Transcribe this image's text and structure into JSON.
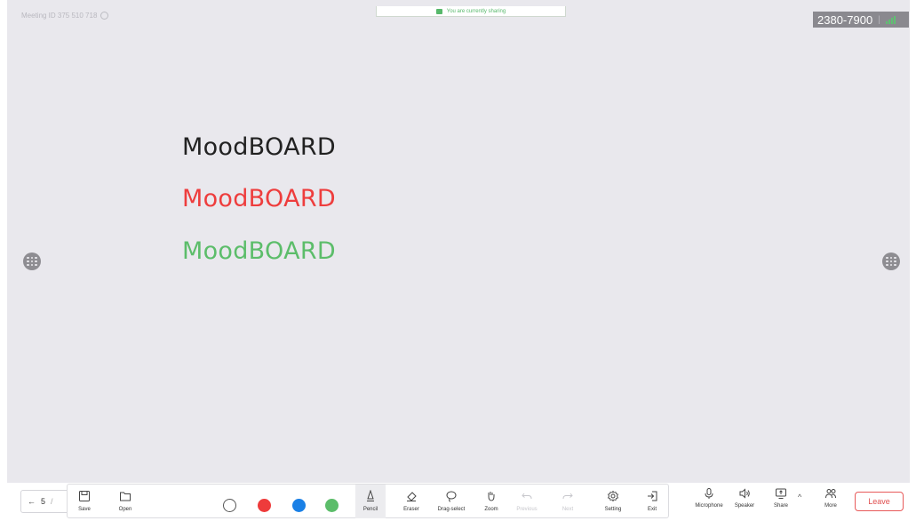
{
  "meeting": {
    "id_label": "Meeting ID 375 510 718"
  },
  "share_banner": {
    "text": "You are currently sharing"
  },
  "timer": {
    "value": "2380-7900",
    "separator": "|"
  },
  "whiteboard": {
    "texts": [
      {
        "text": "MoodBOARD",
        "color": "#222222"
      },
      {
        "text": "MoodBOARD",
        "color": "#ee3d3d"
      },
      {
        "text": "MoodBOARD",
        "color": "#5cbd6a"
      }
    ]
  },
  "page_nav": {
    "back_icon": "arrow-left-icon",
    "page": "5",
    "suffix": "/"
  },
  "toolbar": {
    "save_label": "Save",
    "open_label": "Open",
    "colors": [
      "#ffffff",
      "#ee3b3b",
      "#1a80e6",
      "#5cbd6a"
    ],
    "pencil_label": "Pencil",
    "eraser_label": "Eraser",
    "drag_select_label": "Drag-select",
    "zoom_label": "Zoom",
    "previous_label": "Previous",
    "next_label": "Next",
    "setting_label": "Setting",
    "exit_label": "Exit"
  },
  "controls": {
    "microphone_label": "Microphone",
    "speaker_label": "Speaker",
    "share_label": "Share",
    "more_label": "More",
    "leave_label": "Leave",
    "caret": "^"
  }
}
